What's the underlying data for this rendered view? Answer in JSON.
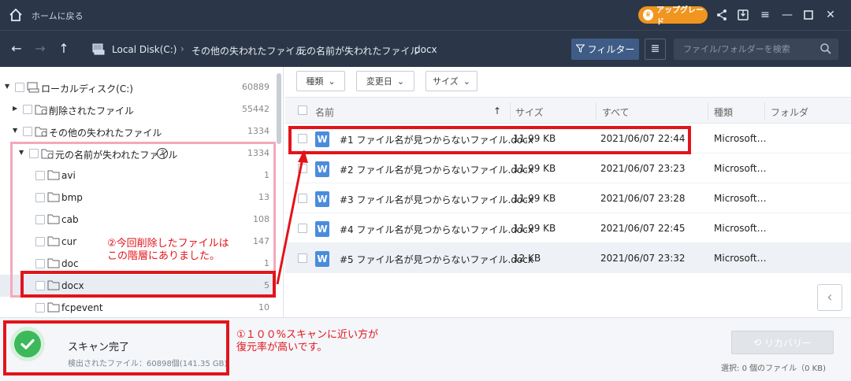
{
  "titlebar": {
    "home_label": "ホームに戻る",
    "upgrade_label": "アップグレード"
  },
  "nav": {
    "breadcrumbs": [
      "Local Disk(C:)",
      "その他の失われたファイル",
      "元の名前が失われたファイル",
      "docx"
    ],
    "filter_label": "フィルター",
    "search_placeholder": "ファイル/フォルダーを検索"
  },
  "tree": {
    "items": [
      {
        "label": "ローカルディスク(C:)",
        "count": "60889"
      },
      {
        "label": "削除されたファイル",
        "count": "55442"
      },
      {
        "label": "その他の失われたファイル",
        "count": "1334"
      },
      {
        "label": "元の名前が失われたファイル",
        "count": "1334"
      },
      {
        "label": "avi",
        "count": "1"
      },
      {
        "label": "bmp",
        "count": "13"
      },
      {
        "label": "cab",
        "count": "108"
      },
      {
        "label": "cur",
        "count": "147"
      },
      {
        "label": "doc",
        "count": "1"
      },
      {
        "label": "docx",
        "count": "5"
      },
      {
        "label": "fcpevent",
        "count": "10"
      }
    ]
  },
  "filters": {
    "type": "種類",
    "modified": "変更日",
    "size": "サイズ"
  },
  "columns": {
    "name": "名前",
    "size": "サイズ",
    "all": "すべて",
    "kind": "種類",
    "folder": "フォルダ"
  },
  "files": [
    {
      "name": "#1 ファイル名が見つからないファイル.docx",
      "size": "11.99 KB",
      "date": "2021/06/07 22:44",
      "kind": "Microsoft…"
    },
    {
      "name": "#2 ファイル名が見つからないファイル.docx",
      "size": "11.99 KB",
      "date": "2021/06/07 23:23",
      "kind": "Microsoft…"
    },
    {
      "name": "#3 ファイル名が見つからないファイル.docx",
      "size": "11.99 KB",
      "date": "2021/06/07 23:28",
      "kind": "Microsoft…"
    },
    {
      "name": "#4 ファイル名が見つからないファイル.docx",
      "size": "11.99 KB",
      "date": "2021/06/07 22:45",
      "kind": "Microsoft…"
    },
    {
      "name": "#5 ファイル名が見つからないファイル.docx",
      "size": "12 KB",
      "date": "2021/06/07 23:32",
      "kind": "Microsoft…"
    }
  ],
  "bottom": {
    "scan_title": "スキャン完了",
    "scan_sub": "検出されたファイル：60898個(141.35 GB)",
    "recover_label": "リカバリー",
    "selected_info": "選択: 0 個のファイル（0 KB)"
  },
  "annotations": {
    "note2_line1": "②今回削除したファイルは",
    "note2_line2": "この階層にありました。",
    "note1_line1": "①１００%スキャンに近い方が",
    "note1_line2": "復元率が高いです。"
  },
  "colors": {
    "titlebar": "#2b3748",
    "accent": "#3f5c87",
    "upgrade": "#f0951e",
    "annotation_red": "#e2141b",
    "success_green": "#3cb95a"
  }
}
